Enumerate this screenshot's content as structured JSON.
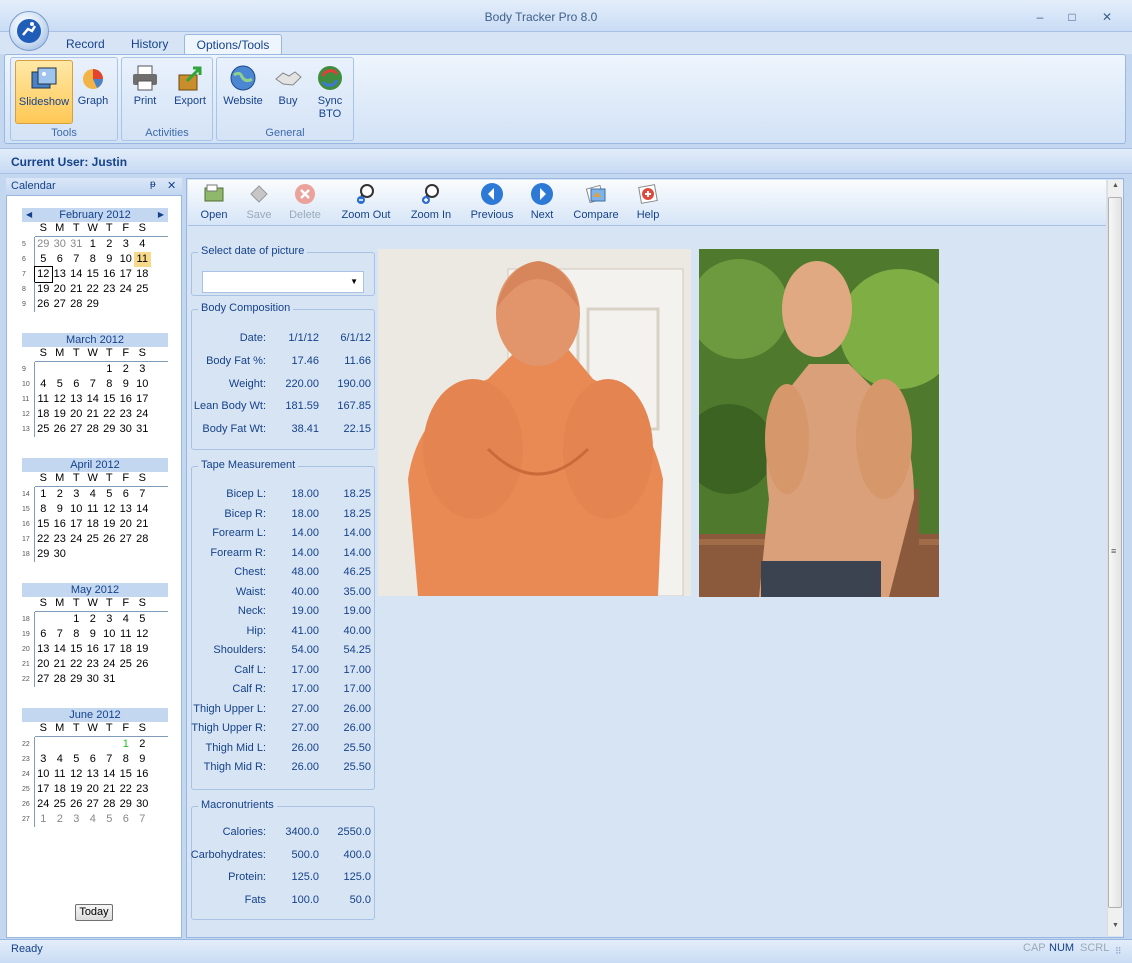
{
  "window": {
    "title": "Body Tracker Pro 8.0",
    "minimize": "–",
    "maximize": "□",
    "close": "✕"
  },
  "tabs": [
    {
      "label": "Record"
    },
    {
      "label": "History"
    },
    {
      "label": "Options/Tools"
    }
  ],
  "ribbon": {
    "groups": [
      {
        "label": "Tools",
        "buttons": [
          {
            "label": "Slideshow"
          },
          {
            "label": "Graph"
          }
        ]
      },
      {
        "label": "Activities",
        "buttons": [
          {
            "label": "Print"
          },
          {
            "label": "Export"
          }
        ]
      },
      {
        "label": "General",
        "buttons": [
          {
            "label": "Website"
          },
          {
            "label": "Buy"
          },
          {
            "label": "Sync BTO"
          }
        ]
      }
    ]
  },
  "current_user": "Current User: Justin",
  "calendar": {
    "title": "Calendar",
    "pin": "ᵽ",
    "close": "✕",
    "today_button": "Today",
    "prev": "◀",
    "next": "▶",
    "dow": [
      "S",
      "M",
      "T",
      "W",
      "T",
      "F",
      "S"
    ],
    "months": [
      {
        "title": "February 2012",
        "weeks": [
          {
            "wn": "5",
            "days": [
              "29",
              "30",
              "31",
              "1",
              "2",
              "3",
              "4"
            ]
          },
          {
            "wn": "6",
            "days": [
              "5",
              "6",
              "7",
              "8",
              "9",
              "10",
              "11"
            ]
          },
          {
            "wn": "7",
            "days": [
              "12",
              "13",
              "14",
              "15",
              "16",
              "17",
              "18"
            ]
          },
          {
            "wn": "8",
            "days": [
              "19",
              "20",
              "21",
              "22",
              "23",
              "24",
              "25"
            ]
          },
          {
            "wn": "9",
            "days": [
              "26",
              "27",
              "28",
              "29",
              "",
              "",
              ""
            ]
          }
        ]
      },
      {
        "title": "March 2012",
        "weeks": [
          {
            "wn": "9",
            "days": [
              "",
              "",
              "",
              "",
              "1",
              "2",
              "3"
            ]
          },
          {
            "wn": "10",
            "days": [
              "4",
              "5",
              "6",
              "7",
              "8",
              "9",
              "10"
            ]
          },
          {
            "wn": "11",
            "days": [
              "11",
              "12",
              "13",
              "14",
              "15",
              "16",
              "17"
            ]
          },
          {
            "wn": "12",
            "days": [
              "18",
              "19",
              "20",
              "21",
              "22",
              "23",
              "24"
            ]
          },
          {
            "wn": "13",
            "days": [
              "25",
              "26",
              "27",
              "28",
              "29",
              "30",
              "31"
            ]
          }
        ]
      },
      {
        "title": "April 2012",
        "weeks": [
          {
            "wn": "14",
            "days": [
              "1",
              "2",
              "3",
              "4",
              "5",
              "6",
              "7"
            ]
          },
          {
            "wn": "15",
            "days": [
              "8",
              "9",
              "10",
              "11",
              "12",
              "13",
              "14"
            ]
          },
          {
            "wn": "16",
            "days": [
              "15",
              "16",
              "17",
              "18",
              "19",
              "20",
              "21"
            ]
          },
          {
            "wn": "17",
            "days": [
              "22",
              "23",
              "24",
              "25",
              "26",
              "27",
              "28"
            ]
          },
          {
            "wn": "18",
            "days": [
              "29",
              "30",
              "",
              "",
              "",
              "",
              ""
            ]
          }
        ]
      },
      {
        "title": "May 2012",
        "weeks": [
          {
            "wn": "18",
            "days": [
              "",
              "",
              "1",
              "2",
              "3",
              "4",
              "5"
            ]
          },
          {
            "wn": "19",
            "days": [
              "6",
              "7",
              "8",
              "9",
              "10",
              "11",
              "12"
            ]
          },
          {
            "wn": "20",
            "days": [
              "13",
              "14",
              "15",
              "16",
              "17",
              "18",
              "19"
            ]
          },
          {
            "wn": "21",
            "days": [
              "20",
              "21",
              "22",
              "23",
              "24",
              "25",
              "26"
            ]
          },
          {
            "wn": "22",
            "days": [
              "27",
              "28",
              "29",
              "30",
              "31",
              "",
              ""
            ]
          }
        ]
      },
      {
        "title": "June 2012",
        "weeks": [
          {
            "wn": "22",
            "days": [
              "",
              "",
              "",
              "",
              "",
              "1",
              "2"
            ]
          },
          {
            "wn": "23",
            "days": [
              "3",
              "4",
              "5",
              "6",
              "7",
              "8",
              "9"
            ]
          },
          {
            "wn": "24",
            "days": [
              "10",
              "11",
              "12",
              "13",
              "14",
              "15",
              "16"
            ]
          },
          {
            "wn": "25",
            "days": [
              "17",
              "18",
              "19",
              "20",
              "21",
              "22",
              "23"
            ]
          },
          {
            "wn": "26",
            "days": [
              "24",
              "25",
              "26",
              "27",
              "28",
              "29",
              "30"
            ]
          },
          {
            "wn": "27",
            "days": [
              "1",
              "2",
              "3",
              "4",
              "5",
              "6",
              "7"
            ]
          }
        ]
      }
    ]
  },
  "toolbar": [
    {
      "label": "Open"
    },
    {
      "label": "Save"
    },
    {
      "label": "Delete"
    },
    {
      "label": "Zoom Out"
    },
    {
      "label": "Zoom In"
    },
    {
      "label": "Previous"
    },
    {
      "label": "Next"
    },
    {
      "label": "Compare"
    },
    {
      "label": "Help"
    }
  ],
  "select_date": {
    "title": "Select date of picture",
    "value": ""
  },
  "body_composition": {
    "title": "Body Composition",
    "rows": [
      {
        "label": "Date:",
        "a": "1/1/12",
        "b": "6/1/12"
      },
      {
        "label": "Body Fat %:",
        "a": "17.46",
        "b": "11.66"
      },
      {
        "label": "Weight:",
        "a": "220.00",
        "b": "190.00"
      },
      {
        "label": "Lean Body Wt:",
        "a": "181.59",
        "b": "167.85"
      },
      {
        "label": "Body Fat Wt:",
        "a": "38.41",
        "b": "22.15"
      }
    ]
  },
  "tape": {
    "title": "Tape Measurement",
    "rows": [
      {
        "label": "Bicep L:",
        "a": "18.00",
        "b": "18.25"
      },
      {
        "label": "Bicep R:",
        "a": "18.00",
        "b": "18.25"
      },
      {
        "label": "Forearm L:",
        "a": "14.00",
        "b": "14.00"
      },
      {
        "label": "Forearm R:",
        "a": "14.00",
        "b": "14.00"
      },
      {
        "label": "Chest:",
        "a": "48.00",
        "b": "46.25"
      },
      {
        "label": "Waist:",
        "a": "40.00",
        "b": "35.00"
      },
      {
        "label": "Neck:",
        "a": "19.00",
        "b": "19.00"
      },
      {
        "label": "Hip:",
        "a": "41.00",
        "b": "40.00"
      },
      {
        "label": "Shoulders:",
        "a": "54.00",
        "b": "54.25"
      },
      {
        "label": "Calf L:",
        "a": "17.00",
        "b": "17.00"
      },
      {
        "label": "Calf R:",
        "a": "17.00",
        "b": "17.00"
      },
      {
        "label": "Thigh Upper L:",
        "a": "27.00",
        "b": "26.00"
      },
      {
        "label": "Thigh Upper R:",
        "a": "27.00",
        "b": "26.00"
      },
      {
        "label": "Thigh Mid L:",
        "a": "26.00",
        "b": "25.50"
      },
      {
        "label": "Thigh Mid R:",
        "a": "26.00",
        "b": "25.50"
      }
    ]
  },
  "macros": {
    "title": "Macronutrients",
    "rows": [
      {
        "label": "Calories:",
        "a": "3400.0",
        "b": "2550.0"
      },
      {
        "label": "Carbohydrates:",
        "a": "500.0",
        "b": "400.0"
      },
      {
        "label": "Protein:",
        "a": "125.0",
        "b": "125.0"
      },
      {
        "label": "Fats",
        "a": "100.0",
        "b": "50.0"
      }
    ]
  },
  "status": {
    "text": "Ready",
    "cap": "CAP",
    "num": "NUM",
    "scrl": "SCRL"
  },
  "colors": {
    "accent": "#15428b",
    "ribbon": "#d2e2f6",
    "selected": "#ffc855"
  }
}
